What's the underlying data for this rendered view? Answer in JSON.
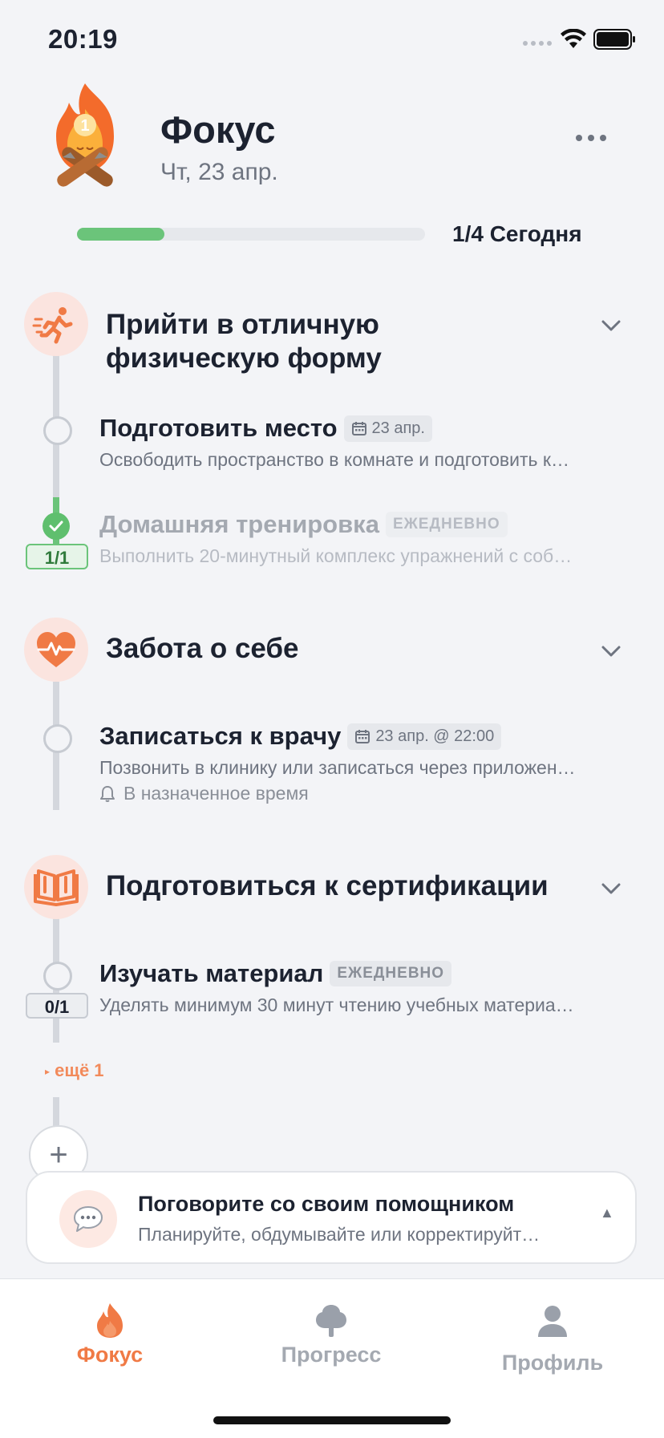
{
  "status_bar": {
    "time": "20:19"
  },
  "header": {
    "title": "Фокус",
    "date": "Чт, 23 апр."
  },
  "progress": {
    "completed": 1,
    "total": 4,
    "fraction": 0.25,
    "label": "1/4 Сегодня"
  },
  "groups": [
    {
      "title_line1": "Прийти в отличную",
      "title_line2": "физическую форму",
      "icon": "running-person-icon",
      "tasks": [
        {
          "title": "Подготовить место",
          "chip": "23 апр.",
          "description": "Освободить пространство в комнате и подготовить к…"
        },
        {
          "title": "Домашняя тренировка",
          "tag": "ЕЖЕДНЕВНО",
          "description": "Выполнить 20-минутный комплекс упражнений с соб…",
          "counter": "1/1",
          "done": true
        }
      ]
    },
    {
      "title_line1": "Забота о себе",
      "icon": "heart-pulse-icon",
      "tasks": [
        {
          "title": "Записаться к врачу",
          "chip": "23 апр. @ 22:00",
          "description": "Позвонить в клинику или записаться через приложен…",
          "reminder": "В назначенное время"
        }
      ]
    },
    {
      "title_line1": "Подготовиться к сертификации",
      "icon": "open-book-icon",
      "tasks": [
        {
          "title": "Изучать материал",
          "tag": "ЕЖЕДНЕВНО",
          "description": "Уделять минимум 30 минут чтению учебных материа…",
          "counter": "0/1"
        }
      ],
      "more_label": "ещё 1"
    }
  ],
  "assistant": {
    "title": "Поговорите со своим помощником",
    "subtitle": "Планируйте, обдумывайте или корректируйт…"
  },
  "tabbar": {
    "tabs": [
      {
        "label": "Фокус",
        "icon": "flame-icon",
        "active": true
      },
      {
        "label": "Прогресс",
        "icon": "tree-icon",
        "active": false
      },
      {
        "label": "Профиль",
        "icon": "person-icon",
        "active": false
      }
    ]
  },
  "colors": {
    "accent": "#f07a45",
    "success": "#6bc47a",
    "background": "#f3f4f7"
  }
}
